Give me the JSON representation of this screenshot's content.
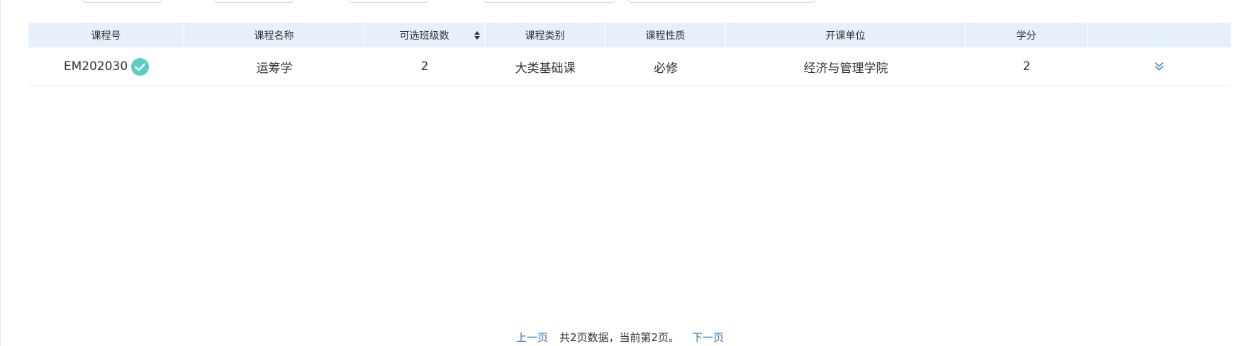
{
  "table": {
    "headers": [
      "课程号",
      "课程名称",
      "可选班级数",
      "课程类别",
      "课程性质",
      "开课单位",
      "学分",
      ""
    ],
    "rows": [
      {
        "course_no": "EM202030",
        "course_name": "运筹学",
        "class_count": "2",
        "category": "大类基础课",
        "nature": "必修",
        "department": "经济与管理学院",
        "credit": "2"
      }
    ]
  },
  "pager": {
    "prev": "上一页",
    "info": "共2页数据，当前第2页。",
    "next": "下一页"
  },
  "colors": {
    "header_bg": "#e6f0fc",
    "check_badge": "#5ccdc4",
    "link": "#2b74c4",
    "expand_icon": "#4a8ee0"
  },
  "icons": {
    "sort": "sort-icon",
    "selected": "check-circle-icon",
    "expand": "double-chevron-down-icon"
  }
}
